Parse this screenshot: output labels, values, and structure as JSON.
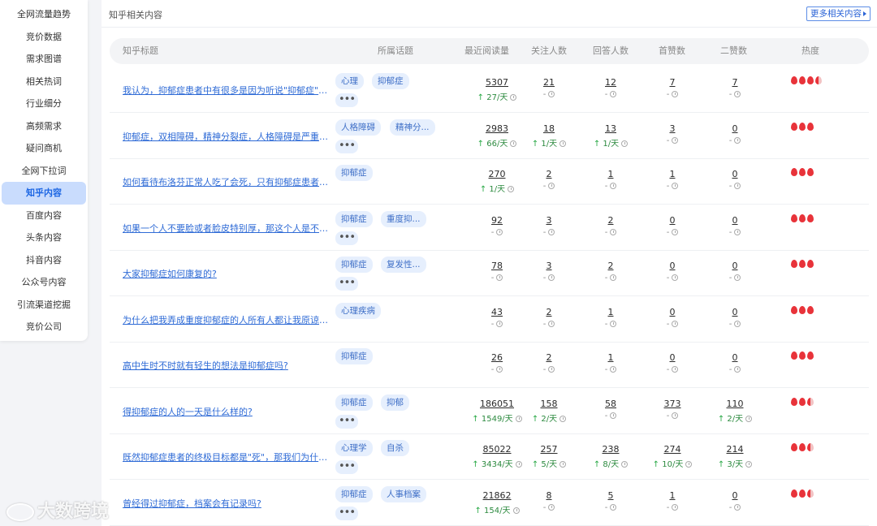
{
  "sidebar": {
    "items": [
      {
        "label": "全网流量趋势"
      },
      {
        "label": "竞价数据"
      },
      {
        "label": "需求图谱"
      },
      {
        "label": "相关热词"
      },
      {
        "label": "行业细分"
      },
      {
        "label": "高频需求"
      },
      {
        "label": "疑问商机"
      },
      {
        "label": "全网下拉词"
      },
      {
        "label": "知乎内容",
        "active": true
      },
      {
        "label": "百度内容"
      },
      {
        "label": "头条内容"
      },
      {
        "label": "抖音内容"
      },
      {
        "label": "公众号内容"
      },
      {
        "label": "引流渠道挖掘"
      },
      {
        "label": "竞价公司"
      }
    ]
  },
  "panel": {
    "title": "知乎相关内容",
    "more_label": "更多相关内容"
  },
  "table": {
    "headers": {
      "title": "知乎标题",
      "topic": "所属话题",
      "reads": "最近阅读量",
      "followers": "关注人数",
      "answers": "回答人数",
      "first_likes": "首赞数",
      "second_likes": "二赞数",
      "heat": "热度"
    },
    "rows": [
      {
        "title": "我认为，抑郁症患者中有很多是因为听说\"抑郁症\"之...",
        "tags": [
          "心理",
          "抑郁症"
        ],
        "more": true,
        "reads": {
          "v": "5307",
          "d": "27/天"
        },
        "followers": {
          "v": "21",
          "d": "-"
        },
        "answers": {
          "v": "12",
          "d": "-"
        },
        "first": {
          "v": "7",
          "d": "-"
        },
        "second": {
          "v": "7",
          "d": "-"
        },
        "heat": 3.5
      },
      {
        "title": "抑郁症，双相障碍，精神分裂症，人格障碍是严重程...",
        "tags": [
          "人格障碍",
          "精神分..."
        ],
        "more": true,
        "reads": {
          "v": "2983",
          "d": "66/天"
        },
        "followers": {
          "v": "18",
          "d": "1/天"
        },
        "answers": {
          "v": "13",
          "d": "1/天"
        },
        "first": {
          "v": "3",
          "d": "-"
        },
        "second": {
          "v": "0",
          "d": "-"
        },
        "heat": 3
      },
      {
        "title": "如何看待布洛芬正常人吃了会死，只有抑郁症患者才...",
        "tags": [
          "抑郁症"
        ],
        "more": false,
        "reads": {
          "v": "270",
          "d": "1/天"
        },
        "followers": {
          "v": "2",
          "d": "-"
        },
        "answers": {
          "v": "1",
          "d": "-"
        },
        "first": {
          "v": "1",
          "d": "-"
        },
        "second": {
          "v": "0",
          "d": "-"
        },
        "heat": 3
      },
      {
        "title": "如果一个人不要脸或者脸皮特别厚，那这个人是不是...",
        "tags": [
          "抑郁症",
          "重度抑..."
        ],
        "more": true,
        "reads": {
          "v": "92",
          "d": "-"
        },
        "followers": {
          "v": "3",
          "d": "-"
        },
        "answers": {
          "v": "2",
          "d": "-"
        },
        "first": {
          "v": "0",
          "d": "-"
        },
        "second": {
          "v": "0",
          "d": "-"
        },
        "heat": 3
      },
      {
        "title": "大家抑郁症如何康复的?",
        "tags": [
          "抑郁症",
          "复发性..."
        ],
        "more": true,
        "reads": {
          "v": "78",
          "d": "-"
        },
        "followers": {
          "v": "3",
          "d": "-"
        },
        "answers": {
          "v": "2",
          "d": "-"
        },
        "first": {
          "v": "0",
          "d": "-"
        },
        "second": {
          "v": "0",
          "d": "-"
        },
        "heat": 3
      },
      {
        "title": "为什么把我弄成重度抑郁症的人所有人都让我原谅她?",
        "tags": [
          "心理疾病"
        ],
        "more": false,
        "reads": {
          "v": "43",
          "d": "-"
        },
        "followers": {
          "v": "2",
          "d": "-"
        },
        "answers": {
          "v": "1",
          "d": "-"
        },
        "first": {
          "v": "0",
          "d": "-"
        },
        "second": {
          "v": "0",
          "d": "-"
        },
        "heat": 3
      },
      {
        "title": "高中生时不时就有轻生的想法是抑郁症吗?",
        "tags": [
          "抑郁症"
        ],
        "more": false,
        "reads": {
          "v": "26",
          "d": "-"
        },
        "followers": {
          "v": "2",
          "d": "-"
        },
        "answers": {
          "v": "1",
          "d": "-"
        },
        "first": {
          "v": "0",
          "d": "-"
        },
        "second": {
          "v": "0",
          "d": "-"
        },
        "heat": 3
      },
      {
        "title": "得抑郁症的人的一天是什么样的?",
        "tags": [
          "抑郁症",
          "抑郁"
        ],
        "more": true,
        "reads": {
          "v": "186051",
          "d": "1549/天"
        },
        "followers": {
          "v": "158",
          "d": "2/天"
        },
        "answers": {
          "v": "58",
          "d": "-"
        },
        "first": {
          "v": "373",
          "d": "-"
        },
        "second": {
          "v": "110",
          "d": "2/天"
        },
        "heat": 2.5
      },
      {
        "title": "既然抑郁症患者的终极目标都是\"死\"，那我们为什么...",
        "tags": [
          "心理学",
          "自杀"
        ],
        "more": true,
        "reads": {
          "v": "85022",
          "d": "3434/天"
        },
        "followers": {
          "v": "257",
          "d": "5/天"
        },
        "answers": {
          "v": "238",
          "d": "8/天"
        },
        "first": {
          "v": "274",
          "d": "10/天"
        },
        "second": {
          "v": "214",
          "d": "3/天"
        },
        "heat": 2.5
      },
      {
        "title": "曾经得过抑郁症，档案会有记录吗?",
        "tags": [
          "抑郁症",
          "人事档案"
        ],
        "more": true,
        "reads": {
          "v": "21862",
          "d": "154/天"
        },
        "followers": {
          "v": "8",
          "d": "-"
        },
        "answers": {
          "v": "5",
          "d": "-"
        },
        "first": {
          "v": "1",
          "d": "-"
        },
        "second": {
          "v": "0",
          "d": "-"
        },
        "heat": 2.5
      }
    ]
  },
  "watermark": {
    "text": "大数跨境"
  },
  "colors": {
    "accent": "#2f6bd6",
    "active_bg": "#c9dcfd",
    "tag_bg": "#e6effd",
    "heat": "#e8333a",
    "up": "#27a844"
  }
}
